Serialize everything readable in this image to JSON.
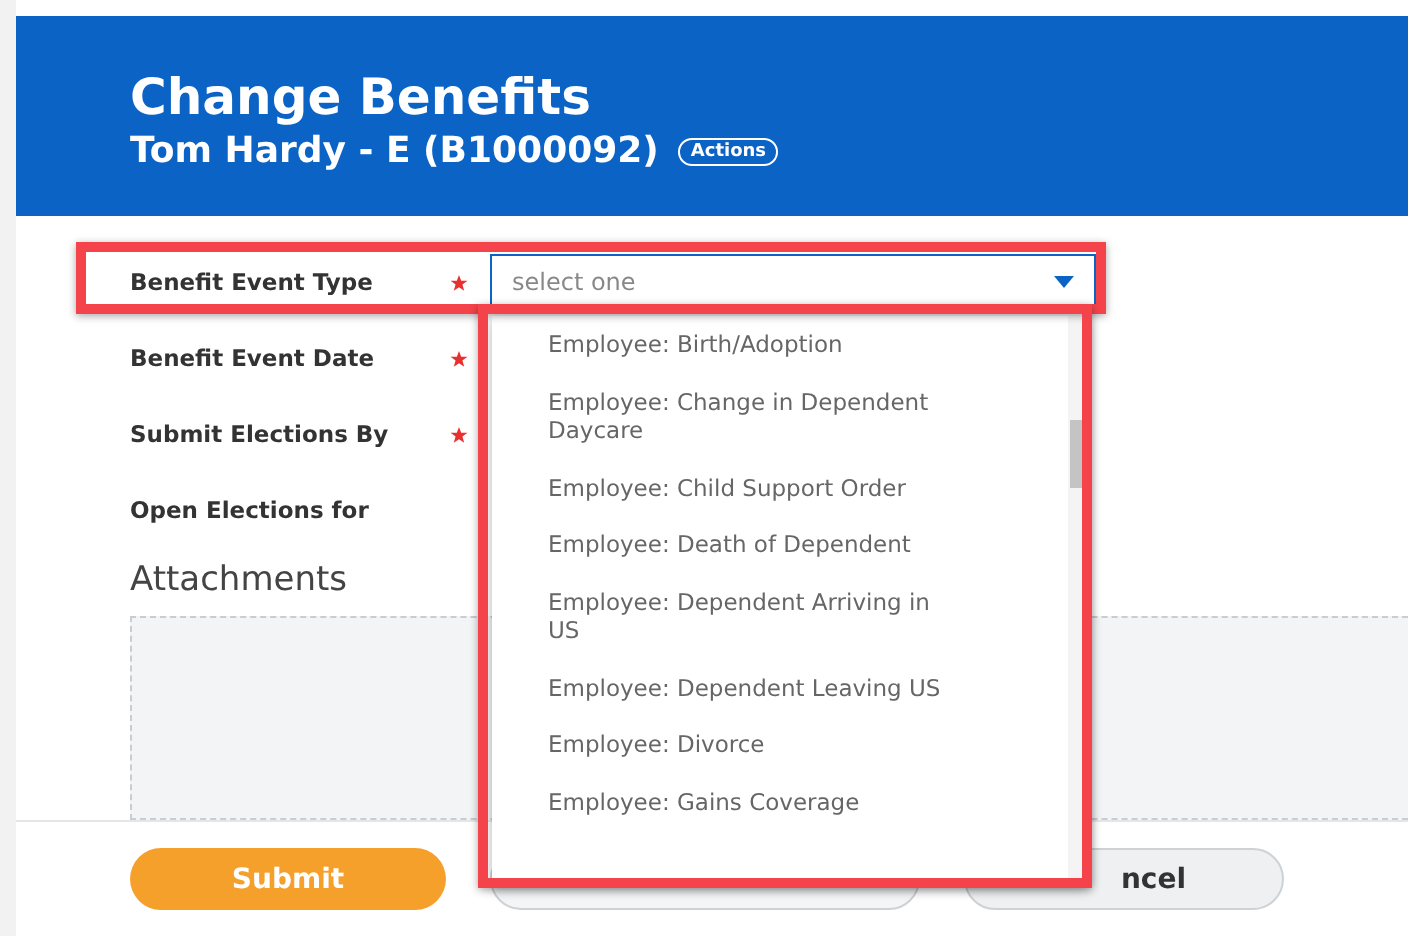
{
  "header": {
    "title": "Change Benefits",
    "subtitle": "Tom Hardy - E (B1000092)",
    "actions_button": "Actions"
  },
  "fields": [
    {
      "label": "Benefit Event Type",
      "required": true,
      "kind": "select",
      "placeholder": "select one"
    },
    {
      "label": "Benefit Event Date",
      "required": true,
      "kind": "hidden"
    },
    {
      "label": "Submit Elections By",
      "required": true,
      "kind": "hidden"
    },
    {
      "label": "Open Elections for",
      "required": false,
      "kind": "hidden"
    }
  ],
  "attachments": {
    "heading": "Attachments"
  },
  "dropdown": {
    "expanded": true,
    "options": [
      {
        "label": "Employee: Birth/Adoption"
      },
      {
        "label": "Employee: Change in Dependent Daycare"
      },
      {
        "label": "Employee: Child Support Order"
      },
      {
        "label": "Employee: Death of Dependent"
      },
      {
        "label": "Employee: Dependent Arriving in US"
      },
      {
        "label": "Employee: Dependent Leaving US"
      },
      {
        "label": "Employee: Divorce"
      },
      {
        "label": "Employee: Gains Coverage"
      }
    ]
  },
  "footer": {
    "buttons": [
      {
        "label": "Submit",
        "kind": "primary"
      },
      {
        "kind": "covered"
      },
      {
        "label": "ncel",
        "kind": "secondary"
      }
    ]
  }
}
